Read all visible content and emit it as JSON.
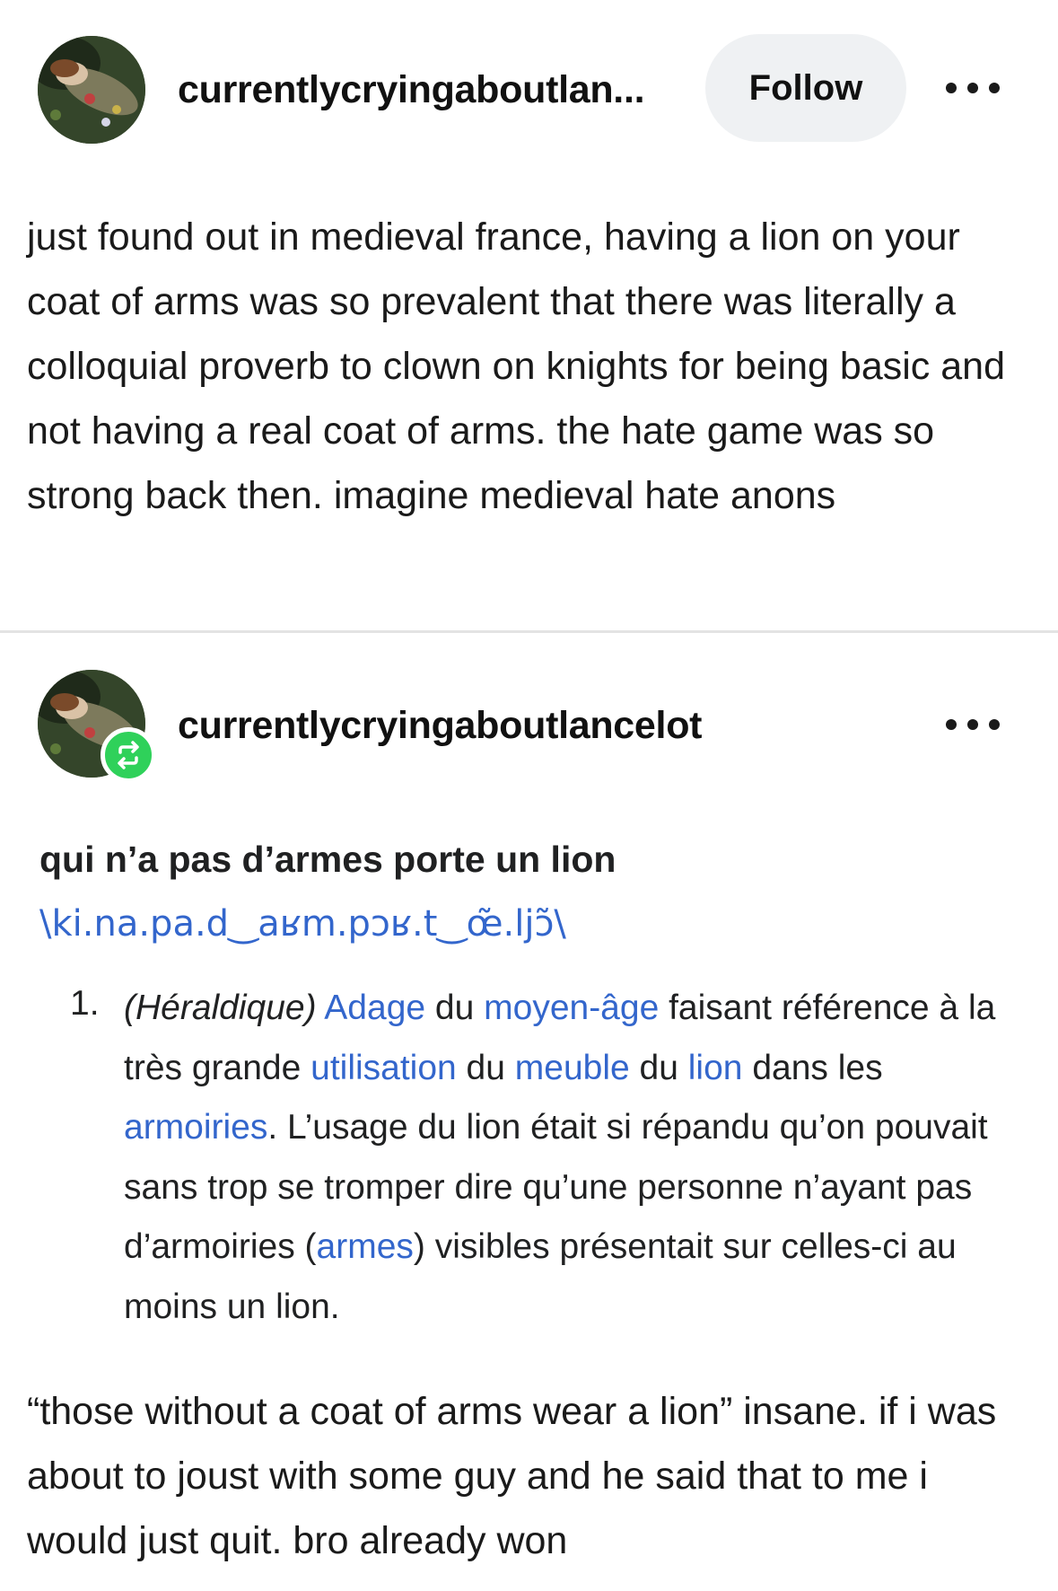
{
  "post": {
    "username_truncated": "currentlycryingaboutlan...",
    "follow_label": "Follow",
    "body": "just found out in medieval france, having a lion on your coat of arms was so prevalent that there was literally a colloquial proverb to clown on knights for being basic and not having a real coat of arms. the hate game was so strong back then. imagine medieval hate anons"
  },
  "reblog": {
    "username": "currentlycryingaboutlancelot",
    "dictionary": {
      "headword": "qui n’a pas d’armes porte un lion",
      "pronunciation": "\\ki.na.pa.d‿aʁm.pɔʁ.t‿œ̃.ljɔ̃\\",
      "definition_number": "1.",
      "definition": {
        "label": "(Héraldique)",
        "link_adage": "Adage",
        "t1": " du ",
        "link_moyen_age": "moyen-âge",
        "t2": " faisant référence à la très grande ",
        "link_utilisation": "utilisation",
        "t3": " du ",
        "link_meuble": "meuble",
        "t4": " du ",
        "link_lion": "lion",
        "t5": " dans les ",
        "link_armoiries": "armoiries",
        "t6": ". L’usage du lion était si répandu qu’on pouvait sans trop se tromper dire qu’une personne n’ayant pas d’armoiries (",
        "link_armes": "armes",
        "t7": ") visibles présentait sur celles-ci au moins un lion."
      }
    },
    "body": "“those without a coat of arms wear a lion” insane. if i was about to joust with some guy and he said that to me i would just quit. bro already won"
  },
  "colors": {
    "link": "#3366cc",
    "reblog_badge": "#2fd15a",
    "follow_bg": "#eff1f3"
  }
}
